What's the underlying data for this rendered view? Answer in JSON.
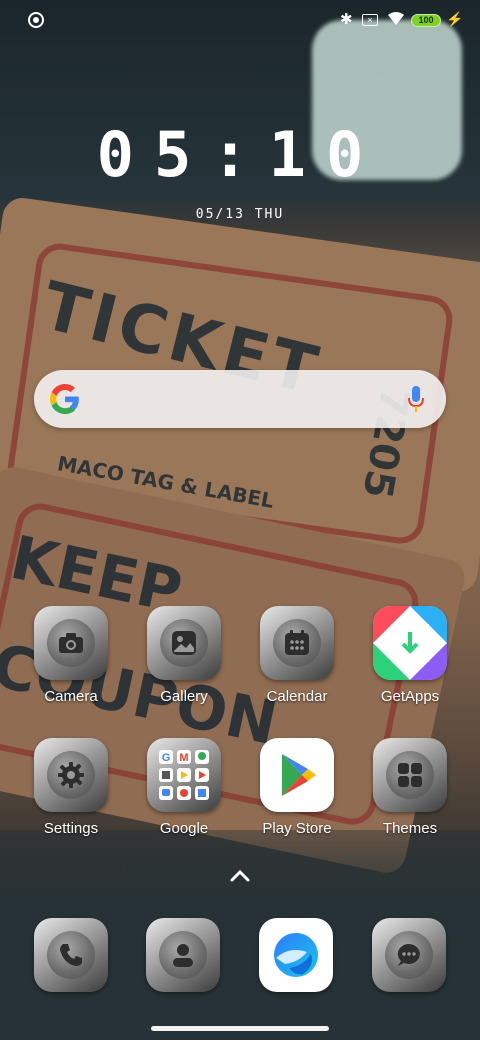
{
  "status_bar": {
    "battery": "100"
  },
  "clock": {
    "time": "05:10",
    "date": "05/13 THU"
  },
  "wallpaper": {
    "words": [
      "TICKET",
      "MACO TAG & LABEL",
      "KEEP",
      "COUPON",
      "7205"
    ]
  },
  "apps": [
    {
      "label": "Camera",
      "icon": "camera-icon"
    },
    {
      "label": "Gallery",
      "icon": "image-icon"
    },
    {
      "label": "Calendar",
      "icon": "calendar-icon"
    },
    {
      "label": "GetApps",
      "icon": "getapps-icon"
    },
    {
      "label": "Settings",
      "icon": "gear-icon"
    },
    {
      "label": "Google",
      "icon": "google-folder-icon"
    },
    {
      "label": "Play Store",
      "icon": "play-store-icon"
    },
    {
      "label": "Themes",
      "icon": "themes-icon"
    }
  ],
  "dock": [
    {
      "name": "phone",
      "icon": "phone-icon"
    },
    {
      "name": "contacts",
      "icon": "contacts-icon"
    },
    {
      "name": "browser",
      "icon": "browser-icon"
    },
    {
      "name": "messages",
      "icon": "message-icon"
    }
  ],
  "colors": {
    "battery": "#7ed321",
    "google_blue": "#4285F4",
    "google_red": "#EA4335",
    "google_yellow": "#FBBC05",
    "google_green": "#34A853"
  }
}
